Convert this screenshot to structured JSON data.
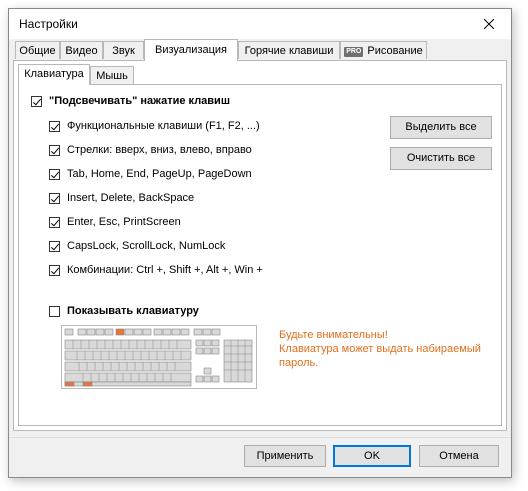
{
  "window": {
    "title": "Настройки"
  },
  "tabs": [
    {
      "label": "Общие"
    },
    {
      "label": "Видео"
    },
    {
      "label": "Звук"
    },
    {
      "label": "Визуализация",
      "active": true
    },
    {
      "label": "Горячие клавиши"
    },
    {
      "label": "Рисование",
      "badge": "PRO"
    }
  ],
  "subtabs": [
    {
      "label": "Клавиатура",
      "active": true
    },
    {
      "label": "Мышь"
    }
  ],
  "highlight": {
    "label": "\"Подсвечивать\" нажатие клавиш",
    "checked": true,
    "options": [
      {
        "label": "Функциональные клавиши (F1, F2, ...)",
        "checked": true
      },
      {
        "label": "Стрелки: вверх, вниз, влево, вправо",
        "checked": true
      },
      {
        "label": "Tab, Home, End, PageUp, PageDown",
        "checked": true
      },
      {
        "label": "Insert, Delete, BackSpace",
        "checked": true
      },
      {
        "label": "Enter, Esc, PrintScreen",
        "checked": true
      },
      {
        "label": "CapsLock, ScrollLock, NumLock",
        "checked": true
      },
      {
        "label": "Комбинации: Ctrl +, Shift +, Alt +, Win +",
        "checked": true
      }
    ],
    "select_all_label": "Выделить все",
    "clear_all_label": "Очистить все"
  },
  "show_keyboard": {
    "label": "Показывать клавиатуру",
    "checked": false,
    "warning_line1": "Будьте внимательны!",
    "warning_line2": "Клавиатура может выдать набираемый",
    "warning_line3": "пароль."
  },
  "footer": {
    "apply_label": "Применить",
    "ok_label": "OK",
    "cancel_label": "Отмена"
  },
  "colors": {
    "warning": "#e06f1d",
    "keyboard_highlight": "#e8743b",
    "keyboard_key": "#d9d9d9"
  }
}
